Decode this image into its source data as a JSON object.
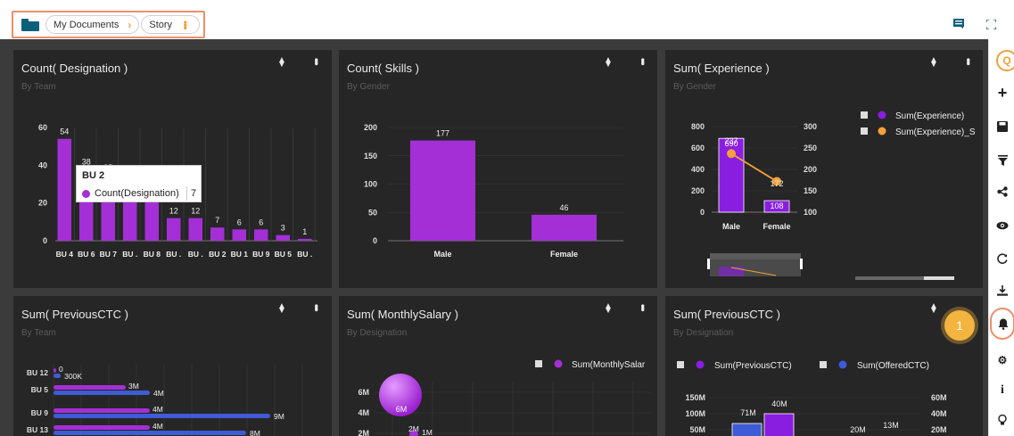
{
  "breadcrumb": {
    "root_label": "My Documents",
    "current_label": "Story"
  },
  "topbar": {
    "comment_icon": "comment-icon",
    "fullscreen_icon": "fullscreen-icon"
  },
  "colors": {
    "accent": "#f0a23b",
    "purple": "#a42fd6",
    "blue": "#3f5bd6",
    "orange": "#f5a03a",
    "panel_bg": "#262626"
  },
  "panels": [
    {
      "title": "Count( Designation )",
      "subtitle": "By Team"
    },
    {
      "title": "Count( Skills )",
      "subtitle": "By Gender"
    },
    {
      "title": "Sum( Experience )",
      "subtitle": "By Gender"
    },
    {
      "title": "Sum( PreviousCTC )",
      "subtitle": "By Team"
    },
    {
      "title": "Sum( MonthlySalary )",
      "subtitle": "By Designation"
    },
    {
      "title": "Sum( PreviousCTC )",
      "subtitle": "By Designation"
    }
  ],
  "tooltip": {
    "header": "BU 2",
    "series": "Count(Designation)",
    "value": "7"
  },
  "badge": {
    "number": "1"
  },
  "sidebar": {
    "icons": [
      "search-icon",
      "plus-icon",
      "save-icon",
      "filter-icon",
      "share-icon",
      "eye-icon",
      "refresh-icon",
      "export-icon",
      "bell-icon",
      "gear-icon",
      "info-icon",
      "bulb-icon"
    ]
  },
  "chart_data": [
    {
      "type": "bar",
      "title": "Count( Designation )",
      "subtitle": "By Team",
      "categories": [
        "BU 4",
        "BU 6",
        "BU 7",
        "BU .",
        "BU 8",
        "BU .",
        "BU .",
        "BU 2",
        "BU 1",
        "BU 9",
        "BU 5",
        "BU ."
      ],
      "values": [
        54,
        38,
        35,
        30,
        30,
        12,
        12,
        7,
        6,
        6,
        3,
        1
      ],
      "data_labels": [
        "54",
        "38",
        "35",
        "",
        "",
        "12",
        "12",
        "7",
        "6",
        "6",
        "3",
        "1"
      ],
      "yticks": [
        "0",
        "20",
        "40",
        "60"
      ],
      "ylim": [
        0,
        60
      ]
    },
    {
      "type": "bar",
      "title": "Count( Skills )",
      "subtitle": "By Gender",
      "categories": [
        "Male",
        "Female"
      ],
      "values": [
        177,
        46
      ],
      "yticks": [
        "0",
        "50",
        "100",
        "150",
        "200"
      ],
      "ylim": [
        0,
        200
      ]
    },
    {
      "type": "bar",
      "title": "Sum( Experience )",
      "subtitle": "By Gender",
      "categories": [
        "Male",
        "Female"
      ],
      "series": [
        {
          "name": "Sum(Experience)",
          "values": [
            690,
            108
          ],
          "labels": [
            "690",
            "108"
          ]
        },
        {
          "name": "Sum(Experience)_S",
          "values": [
            237,
            172
          ],
          "labels": [
            "237",
            "172"
          ]
        }
      ],
      "yticks_left": [
        "0",
        "200",
        "400",
        "600",
        "800"
      ],
      "yticks_right": [
        "100",
        "150",
        "200",
        "250",
        "300"
      ],
      "ylim": [
        0,
        800
      ],
      "y2lim": [
        100,
        300
      ]
    },
    {
      "type": "bar",
      "title": "Sum( PreviousCTC )",
      "subtitle": "By Team",
      "categories": [
        "BU 12",
        "BU 5",
        "BU 9",
        "BU 13"
      ],
      "series": [
        {
          "values": [
            0,
            3,
            4,
            4
          ],
          "labels": [
            "0",
            "3M",
            "4M",
            "4M"
          ]
        },
        {
          "values": [
            0.3,
            4,
            9,
            8
          ],
          "labels": [
            "300K",
            "4M",
            "9M",
            "8M"
          ]
        }
      ]
    },
    {
      "type": "scatter",
      "title": "Sum( MonthlySalary )",
      "subtitle": "By Designation",
      "legend": [
        "Sum(MonthlySalar"
      ],
      "yticks": [
        "2M",
        "4M",
        "6M"
      ],
      "labels": [
        "6M",
        "2M",
        "1M"
      ]
    },
    {
      "type": "bar",
      "title": "Sum( PreviousCTC )",
      "subtitle": "By Designation",
      "series": [
        {
          "name": "Sum(PreviousCTC)",
          "values": [
            71,
            40,
            20
          ]
        },
        {
          "name": "Sum(OfferedCTC)",
          "values": [
            13
          ]
        }
      ],
      "labels": [
        "71M",
        "40M",
        "20M",
        "13M"
      ],
      "yticks_left": [
        "50M",
        "100M",
        "150M"
      ],
      "yticks_right": [
        "20M",
        "40M",
        "60M"
      ]
    }
  ]
}
